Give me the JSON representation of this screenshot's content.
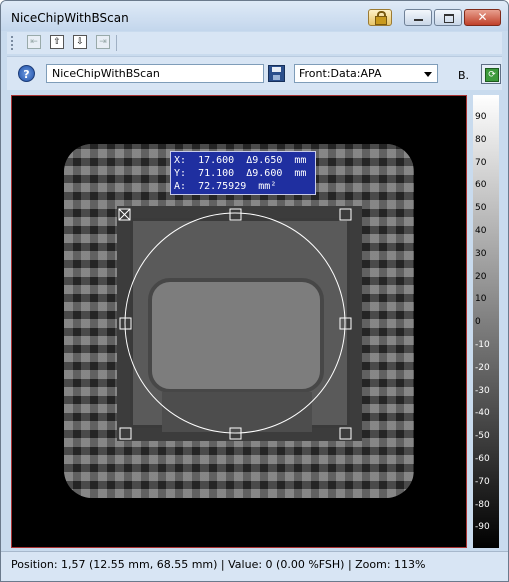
{
  "window": {
    "title": "NiceChipWithBScan",
    "close_glyph": "✕"
  },
  "toolbar": {
    "nav": [
      {
        "name": "first-icon",
        "glyph": "⇤",
        "enabled": false
      },
      {
        "name": "up-icon",
        "glyph": "⇧",
        "enabled": true
      },
      {
        "name": "down-icon",
        "glyph": "⇩",
        "enabled": true
      },
      {
        "name": "last-icon",
        "glyph": "⇥",
        "enabled": false
      }
    ]
  },
  "datapanel": {
    "help_glyph": "?",
    "name_value": "NiceChipWithBScan",
    "source_select": "Front:Data:APA",
    "b_label": "B.",
    "refresh_glyph": "⟳"
  },
  "measurement": {
    "line_x": "X:  17.600  Δ9.650  mm",
    "line_y": "Y:  71.100  Δ9.600  mm",
    "line_a": "A:  72.75929  mm²"
  },
  "colorscale": {
    "ticks": [
      "90",
      "80",
      "70",
      "60",
      "50",
      "40",
      "30",
      "20",
      "10",
      "0",
      "-10",
      "-20",
      "-30",
      "-40",
      "-50",
      "-60",
      "-70",
      "-80",
      "-90"
    ],
    "top": "#ffffff",
    "bottom": "#000000"
  },
  "status": {
    "text": "Position: 1,57 (12.55 mm, 68.55 mm)  |  Value: 0 (0.00 %FSH)  |  Zoom: 113%"
  },
  "colors": {
    "viewer_border": "#aa3333",
    "label_bg": "#1f2fa0"
  }
}
